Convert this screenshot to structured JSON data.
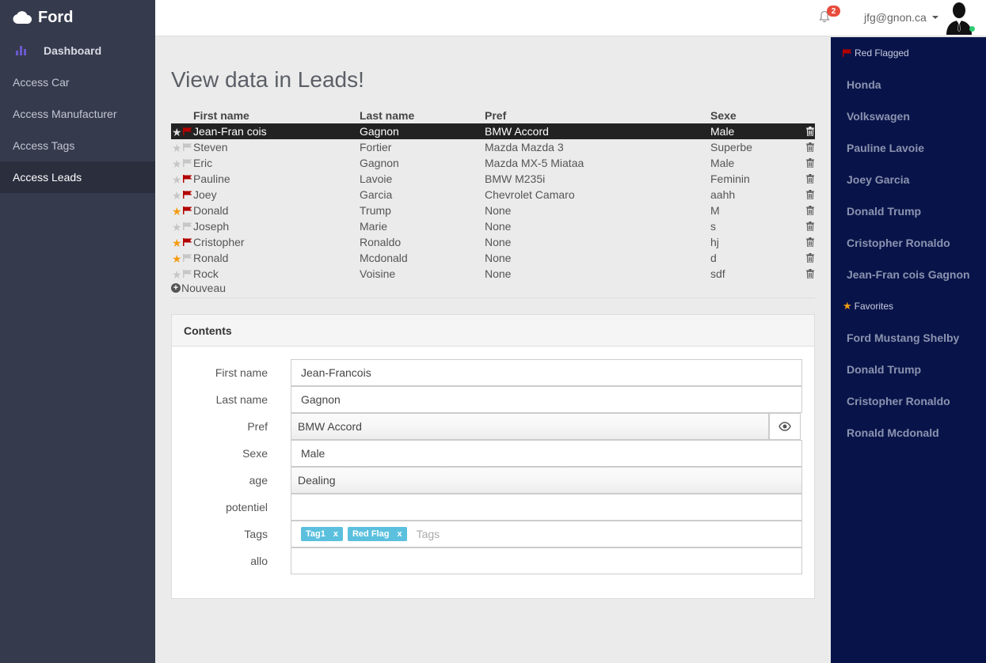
{
  "app": {
    "brand": "Ford"
  },
  "sidebar": {
    "items": [
      {
        "label": "Dashboard"
      },
      {
        "label": "Access Car"
      },
      {
        "label": "Access Manufacturer"
      },
      {
        "label": "Access Tags"
      },
      {
        "label": "Access Leads"
      }
    ]
  },
  "topbar": {
    "notification_count": "2",
    "user_email": "jfg@gnon.ca"
  },
  "page": {
    "title": "View data in Leads!"
  },
  "leads": {
    "headers": {
      "first": "First name",
      "last": "Last name",
      "pref": "Pref",
      "sexe": "Sexe"
    },
    "rows": [
      {
        "first": "Jean-Fran cois",
        "last": "Gagnon",
        "pref": "BMW Accord",
        "sexe": "Male",
        "starred": false,
        "flagged": true
      },
      {
        "first": "Steven",
        "last": "Fortier",
        "pref": "Mazda Mazda 3",
        "sexe": "Superbe",
        "starred": false,
        "flagged": false
      },
      {
        "first": "Eric",
        "last": "Gagnon",
        "pref": "Mazda MX-5 Miataa",
        "sexe": "Male",
        "starred": false,
        "flagged": false
      },
      {
        "first": "Pauline",
        "last": "Lavoie",
        "pref": "BMW M235i",
        "sexe": "Feminin",
        "starred": false,
        "flagged": true
      },
      {
        "first": "Joey",
        "last": "Garcia",
        "pref": "Chevrolet Camaro",
        "sexe": "aahh",
        "starred": false,
        "flagged": true
      },
      {
        "first": "Donald",
        "last": "Trump",
        "pref": "None",
        "sexe": "M",
        "starred": true,
        "flagged": true
      },
      {
        "first": "Joseph",
        "last": "Marie",
        "pref": "None",
        "sexe": "s",
        "starred": false,
        "flagged": false
      },
      {
        "first": "Cristopher",
        "last": "Ronaldo",
        "pref": "None",
        "sexe": "hj",
        "starred": true,
        "flagged": true
      },
      {
        "first": "Ronald",
        "last": "Mcdonald",
        "pref": "None",
        "sexe": "d",
        "starred": true,
        "flagged": false
      },
      {
        "first": "Rock",
        "last": "Voisine",
        "pref": "None",
        "sexe": "sdf",
        "starred": false,
        "flagged": false
      }
    ],
    "new_label": "Nouveau"
  },
  "contents": {
    "title": "Contents",
    "fields": {
      "first_name": {
        "label": "First name",
        "value": "Jean-Francois"
      },
      "last_name": {
        "label": "Last name",
        "value": "Gagnon"
      },
      "pref": {
        "label": "Pref",
        "value": "BMW Accord"
      },
      "sexe": {
        "label": "Sexe",
        "value": "Male"
      },
      "age": {
        "label": "age",
        "value": "Dealing"
      },
      "potentiel": {
        "label": "potentiel",
        "value": ""
      },
      "tags": {
        "label": "Tags",
        "values": [
          "Tag1",
          "Red Flag"
        ],
        "placeholder": "Tags"
      },
      "allo": {
        "label": "allo",
        "value": ""
      }
    }
  },
  "right_panel": {
    "red_flagged": {
      "title": "Red Flagged",
      "items": [
        "Honda",
        "Volkswagen",
        "Pauline Lavoie",
        "Joey Garcia",
        "Donald Trump",
        "Cristopher Ronaldo",
        "Jean-Fran cois Gagnon"
      ]
    },
    "favorites": {
      "title": "Favorites",
      "items": [
        "Ford Mustang Shelby",
        "Donald Trump",
        "Cristopher Ronaldo",
        "Ronald Mcdonald"
      ]
    }
  },
  "colors": {
    "star_on": "#f39c12",
    "flag_on": "#b30000",
    "flag_off": "#c6c6c6",
    "tag_bg": "#5bc0de",
    "sidebar_bg": "#363a4d",
    "right_panel_bg": "#081449"
  }
}
